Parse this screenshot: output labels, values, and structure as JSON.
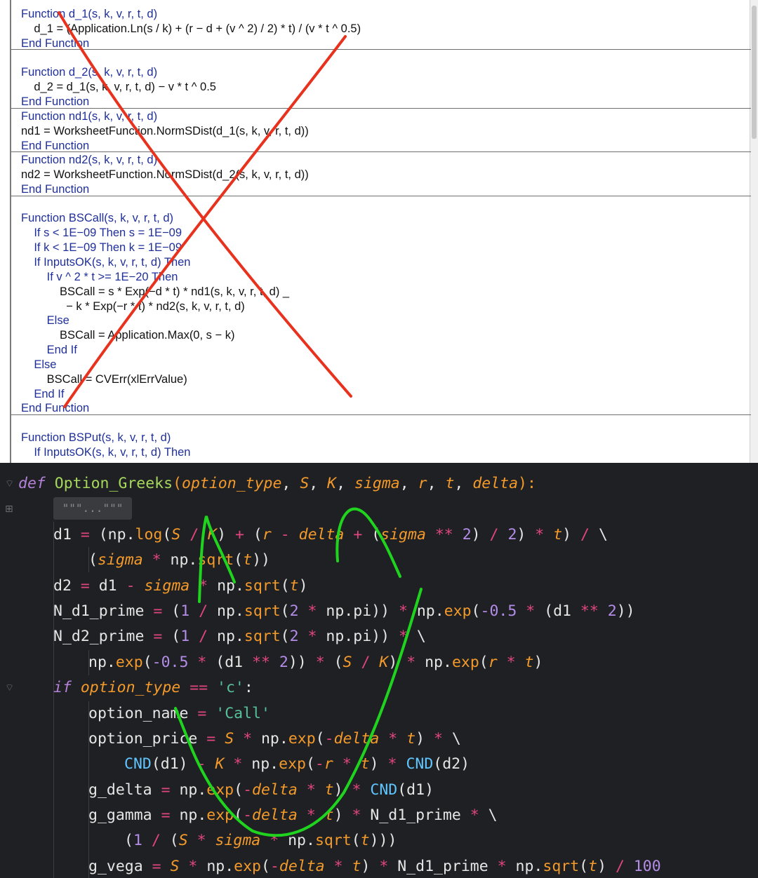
{
  "vba_panel": {
    "lines": [
      {
        "text": "Function d_1(s, k, v, r, t, d)",
        "kind": "kw"
      },
      {
        "text": "    d_1 = (Application.Ln(s / k) + (r − d + (v ^ 2) / 2) * t) / (v * t ^ 0.5)",
        "kind": "code"
      },
      {
        "text": "End Function",
        "kind": "kw"
      },
      {
        "text": "Function d_2(s, k, v, r, t, d)",
        "kind": "kw"
      },
      {
        "text": "    d_2 = d_1(s, k, v, r, t, d) − v * t ^ 0.5",
        "kind": "code"
      },
      {
        "text": "End Function",
        "kind": "kw"
      },
      {
        "text": "Function nd1(s, k, v, r, t, d)",
        "kind": "kw"
      },
      {
        "text": "nd1 = WorksheetFunction.NormSDist(d_1(s, k, v, r, t, d))",
        "kind": "code"
      },
      {
        "text": "End Function",
        "kind": "kw"
      },
      {
        "text": "Function nd2(s, k, v, r, t, d)",
        "kind": "kw"
      },
      {
        "text": "nd2 = WorksheetFunction.NormSDist(d_2(s, k, v, r, t, d))",
        "kind": "code"
      },
      {
        "text": "End Function",
        "kind": "kw"
      },
      {
        "text": "Function BSCall(s, k, v, r, t, d)",
        "kind": "kw"
      },
      {
        "text": "    If s < 1E−09 Then s = 1E−09",
        "kind": "kw"
      },
      {
        "text": "    If k < 1E−09 Then k = 1E−09",
        "kind": "kw"
      },
      {
        "text": "    If InputsOK(s, k, v, r, t, d) Then",
        "kind": "kw"
      },
      {
        "text": "        If v ^ 2 * t >= 1E−20 Then",
        "kind": "kw"
      },
      {
        "text": "            BSCall = s * Exp(−d * t) * nd1(s, k, v, r, t, d) _",
        "kind": "code"
      },
      {
        "text": "              − k * Exp(−r * t) * nd2(s, k, v, r, t, d)",
        "kind": "code"
      },
      {
        "text": "        Else",
        "kind": "kw"
      },
      {
        "text": "            BSCall = Application.Max(0, s − k)",
        "kind": "code"
      },
      {
        "text": "        End If",
        "kind": "kw"
      },
      {
        "text": "    Else",
        "kind": "kw"
      },
      {
        "text": "        BSCall = CVErr(xlErrValue)",
        "kind": "code"
      },
      {
        "text": "    End If",
        "kind": "kw"
      },
      {
        "text": "End Function",
        "kind": "kw"
      },
      {
        "text": "Function BSPut(s, k, v, r, t, d)",
        "kind": "kw"
      },
      {
        "text": "    If InputsOK(s, k, v, r, t, d) Then",
        "kind": "kw"
      }
    ]
  },
  "python_panel": {
    "docstring_placeholder": "\"\"\"...\"\"\"",
    "code": {
      "def_kw": "def",
      "func_name": "Option_Greeks",
      "params": [
        "option_type",
        "S",
        "K",
        "sigma",
        "r",
        "t",
        "delta"
      ],
      "option_call": "'c'",
      "option_name_value": "'Call'"
    }
  },
  "annotations": {
    "red_cross": "strike-through cross over VBA code",
    "green_scribble": "hand-drawn green loop over Python code",
    "red_color": "#e8321e",
    "green_color": "#1fd31f"
  },
  "colors": {
    "vba_keyword": "#1f2f9a",
    "python_background": "#1f2023",
    "python_keyword": "#b481d8",
    "python_function": "#a6d85b",
    "python_parameter": "#f39a2b",
    "python_operator": "#e0467d",
    "python_number": "#b48de8",
    "python_string": "#58c09a",
    "python_cnd": "#5fc6ff"
  }
}
